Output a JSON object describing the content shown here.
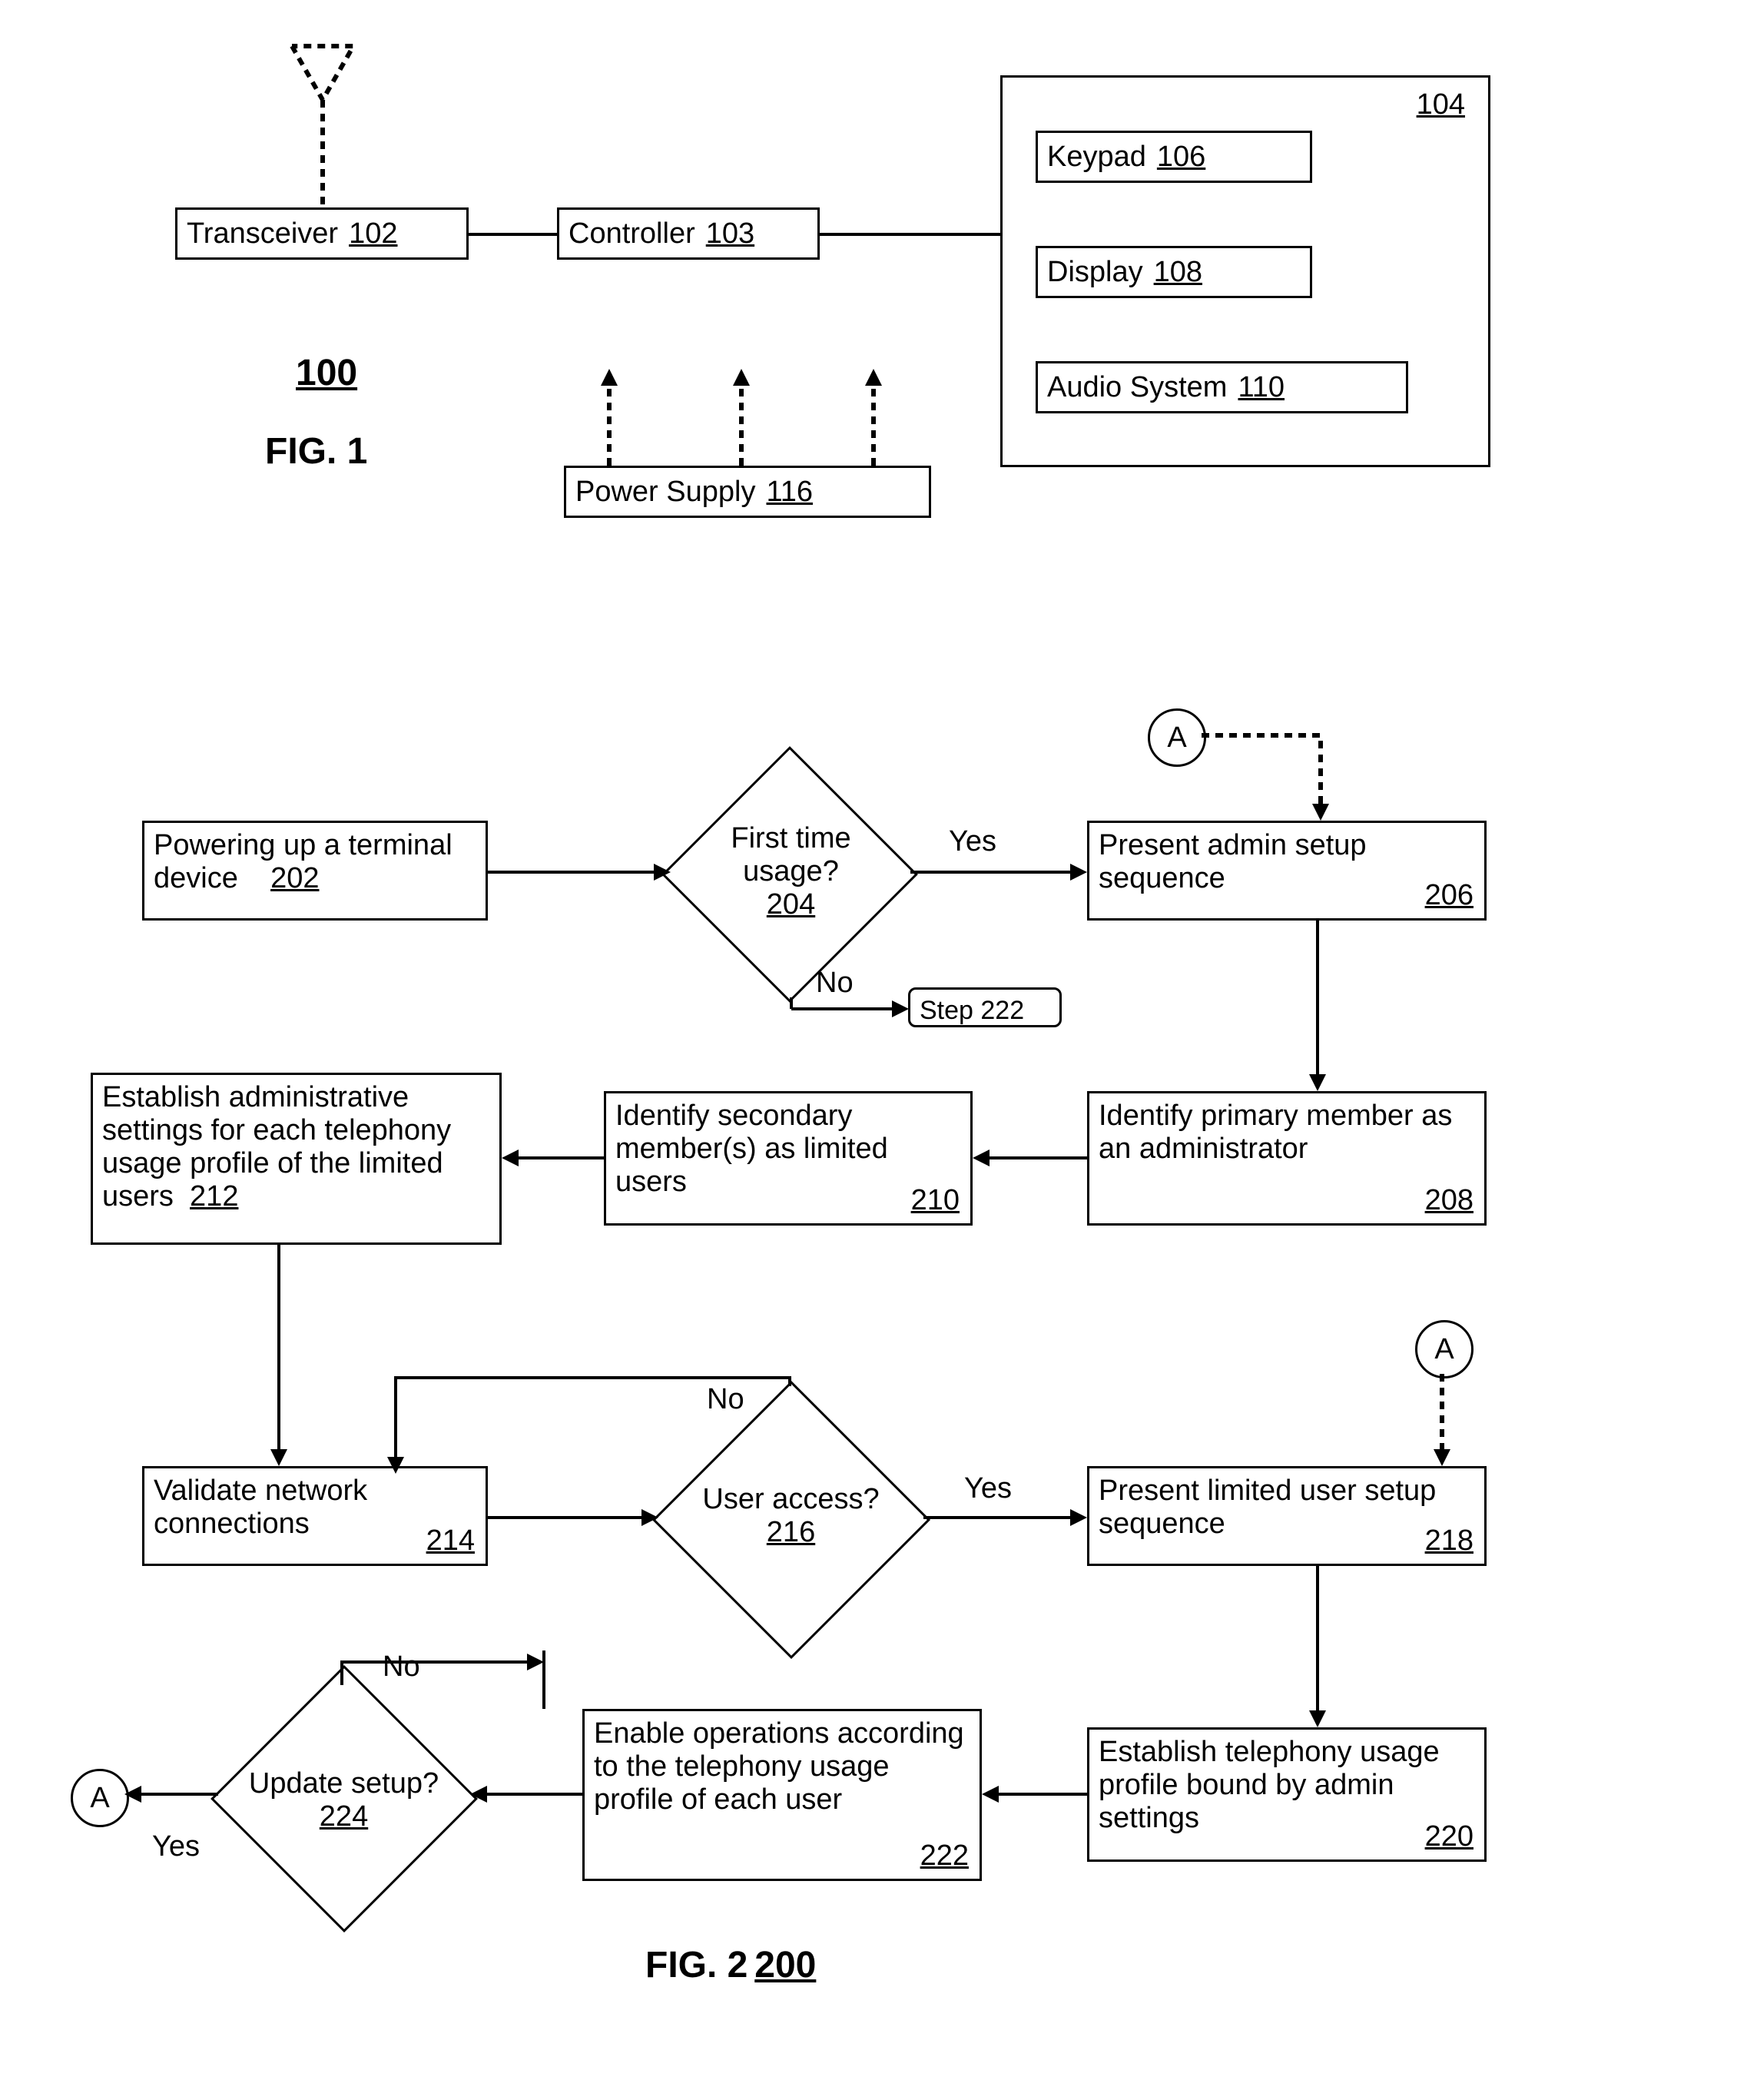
{
  "fig1": {
    "num": "100",
    "label": "FIG. 1",
    "transceiver": {
      "text": "Transceiver",
      "ref": "102"
    },
    "controller": {
      "text": "Controller",
      "ref": "103"
    },
    "io_ref": "104",
    "keypad": {
      "text": "Keypad",
      "ref": "106"
    },
    "display": {
      "text": "Display",
      "ref": "108"
    },
    "audio": {
      "text": "Audio System",
      "ref": "110"
    },
    "power": {
      "text": "Power Supply",
      "ref": "116"
    }
  },
  "fig2": {
    "label": "FIG. 2",
    "num": "200",
    "connector": "A",
    "b202": {
      "text": "Powering up a terminal device",
      "ref": "202"
    },
    "b204": {
      "text": "First time usage?",
      "ref": "204"
    },
    "b206": {
      "text": "Present admin setup sequence",
      "ref": "206"
    },
    "b208": {
      "text": "Identify primary member as an administrator",
      "ref": "208"
    },
    "b210": {
      "text": "Identify secondary member(s) as limited users",
      "ref": "210"
    },
    "b212": {
      "text": "Establish administrative settings for each telephony usage profile of the limited users",
      "ref": "212"
    },
    "b214": {
      "text": "Validate network connections",
      "ref": "214"
    },
    "b216": {
      "text": "User access?",
      "ref": "216"
    },
    "b218": {
      "text": "Present limited user setup sequence",
      "ref": "218"
    },
    "b220": {
      "text": "Establish telephony usage profile bound by admin settings",
      "ref": "220"
    },
    "b222": {
      "text": "Enable operations according to the telephony usage profile of each user",
      "ref": "222"
    },
    "b224": {
      "text": "Update setup?",
      "ref": "224"
    },
    "step222": {
      "text": "Step 222"
    },
    "yes": "Yes",
    "no": "No"
  }
}
